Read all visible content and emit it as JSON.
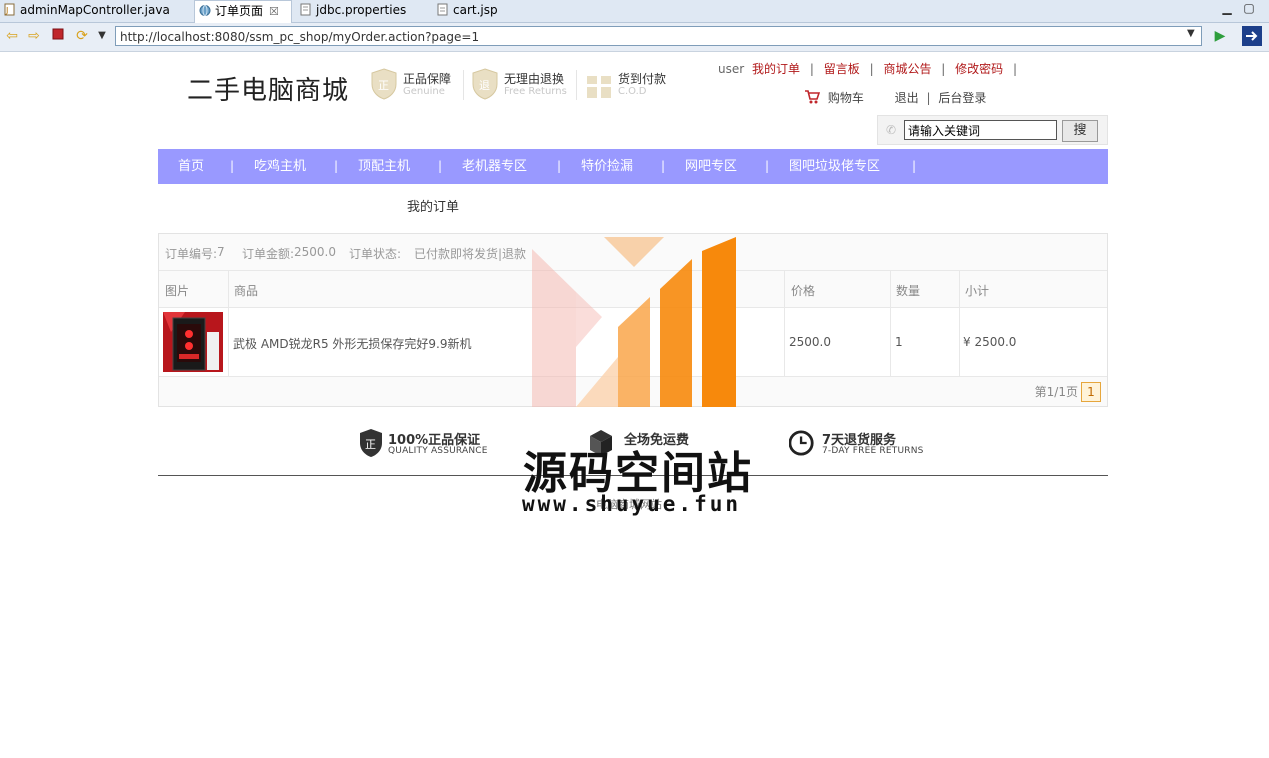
{
  "tabs": [
    {
      "label": "adminMapController.java",
      "icon": "java-file-icon",
      "active": false
    },
    {
      "label": "订单页面",
      "icon": "globe-icon",
      "active": true,
      "close": "☒"
    },
    {
      "label": "jdbc.properties",
      "icon": "properties-file-icon",
      "active": false
    },
    {
      "label": "cart.jsp",
      "icon": "jsp-file-icon",
      "active": false
    }
  ],
  "toolbar": {
    "url": "http://localhost:8080/ssm_pc_shop/myOrder.action?page=1"
  },
  "header": {
    "site_title": "二手电脑商城",
    "badges": [
      {
        "title": "正品保障",
        "subtitle": "Genuine",
        "icon": "genuine-shield-icon"
      },
      {
        "title": "无理由退换",
        "subtitle": "Free Returns",
        "icon": "returns-shield-icon"
      },
      {
        "title": "货到付款",
        "subtitle": "C.O.D",
        "icon": "gift-box-icon"
      }
    ],
    "user_label": "user",
    "links": [
      "我的订单",
      "留言板",
      "商城公告",
      "修改密码"
    ],
    "separator": "|",
    "cart_label": "购物车",
    "logout_label": "退出",
    "admin_label": "后台登录"
  },
  "search": {
    "value": "请输入关键词",
    "button_label": "搜"
  },
  "nav": {
    "items": [
      "首页",
      "吃鸡主机",
      "顶配主机",
      "老机器专区",
      "特价捡漏",
      "网吧专区",
      "图吧垃圾佬专区"
    ],
    "separator": "|"
  },
  "breadcrumb": "我的订单",
  "order": {
    "id_label": "订单编号:",
    "id_value": "7",
    "amount_label": "订单金额:",
    "amount_value": "2500.0",
    "status_label": "订单状态:",
    "status_value": "已付款即将发货|",
    "refund_label": "退款",
    "columns": [
      "图片",
      "商品",
      "价格",
      "数量",
      "小计"
    ],
    "items": [
      {
        "name": "武极 AMD锐龙R5 外形无损保存完好9.9新机",
        "price": "2500.0",
        "qty": "1",
        "subtotal": "¥ 2500.0"
      }
    ],
    "pager_text": "第1/1页",
    "current_page": "1"
  },
  "services": [
    {
      "title": "100%正品保证",
      "subtitle": "QUALITY ASSURANCE",
      "icon": "shield-badge-icon"
    },
    {
      "title": "全场免运费",
      "subtitle": "",
      "icon": "box-icon"
    },
    {
      "title": "7天退货服务",
      "subtitle": "7-DAY FREE RETURNS",
      "icon": "clock-icon"
    }
  ],
  "footer_text": "电脑商城网站",
  "watermark": {
    "title": "源码空间站",
    "url": "www.shuyue.fun"
  },
  "colors": {
    "nav_bg": "#9999ff",
    "link_red": "#b1191a",
    "watermark_orange": "#f7890c"
  }
}
